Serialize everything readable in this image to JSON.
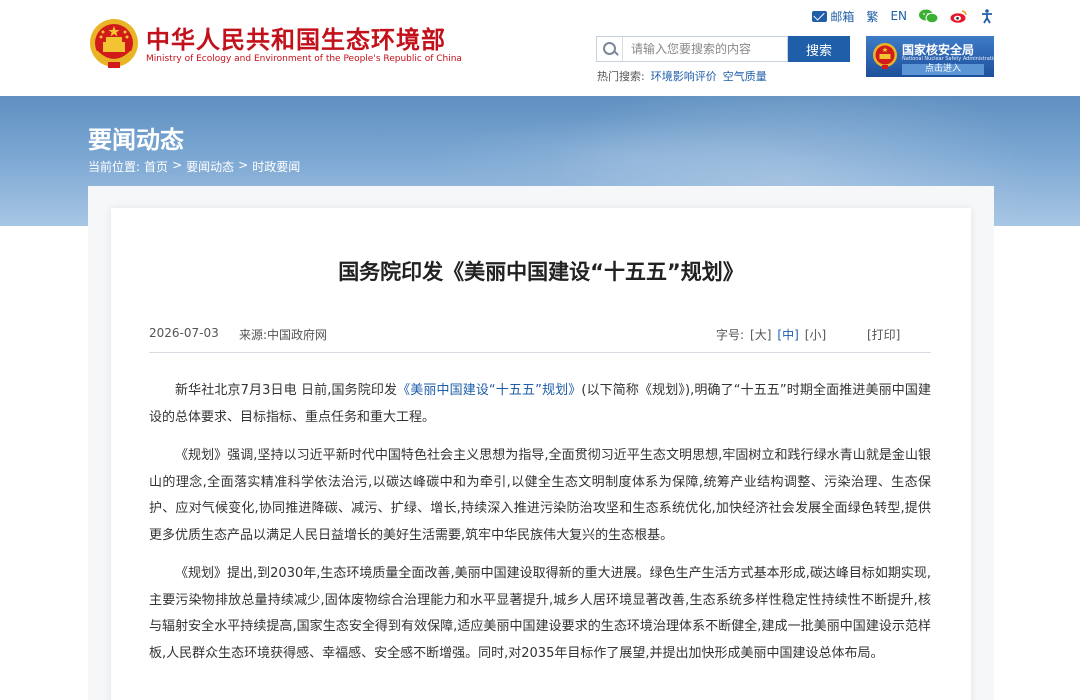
{
  "header": {
    "ministry_cn": "中华人民共和国生态环境部",
    "ministry_en": "Ministry of Ecology and Environment of the People's Republic of China",
    "top_links": {
      "mail": "邮箱",
      "traditional": "繁",
      "english": "EN"
    },
    "search": {
      "placeholder": "请输入您要搜索的内容",
      "button": "搜索"
    },
    "hot_search": {
      "label": "热门搜索:",
      "items": [
        "环境影响评价",
        "空气质量"
      ]
    },
    "nnsa": {
      "name": "国家核安全局",
      "name_en": "National Nuclear Safety Administration",
      "enter": "点击进入"
    }
  },
  "banner": {
    "title": "要闻动态",
    "breadcrumb": {
      "prefix": "当前位置:",
      "items": [
        "首页",
        "要闻动态",
        "时政要闻"
      ],
      "sep": ">"
    }
  },
  "article": {
    "title": "国务院印发《美丽中国建设“十五五”规划》",
    "date": "2026-07-03",
    "source": "来源:中国政府网",
    "font_size": {
      "label": "字号:",
      "large": "[大]",
      "medium": "[中]",
      "small": "[小]"
    },
    "print": "[打印]",
    "paragraph1": {
      "before": "新华社北京7月3日电 日前,国务院印发",
      "link": "《美丽中国建设“十五五”规划》",
      "after": "(以下简称《规划》),明确了“十五五”时期全面推进美丽中国建设的总体要求、目标指标、重点任务和重大工程。"
    },
    "paragraph2": "《规划》强调,坚持以习近平新时代中国特色社会主义思想为指导,全面贯彻习近平生态文明思想,牢固树立和践行绿水青山就是金山银山的理念,全面落实精准科学依法治污,以碳达峰碳中和为牵引,以健全生态文明制度体系为保障,统筹产业结构调整、污染治理、生态保护、应对气候变化,协同推进降碳、减污、扩绿、增长,持续深入推进污染防治攻坚和生态系统优化,加快经济社会发展全面绿色转型,提供更多优质生态产品以满足人民日益增长的美好生活需要,筑牢中华民族伟大复兴的生态根基。",
    "paragraph3": "《规划》提出,到2030年,生态环境质量全面改善,美丽中国建设取得新的重大进展。绿色生产生活方式基本形成,碳达峰目标如期实现,主要污染物排放总量持续减少,固体废物综合治理能力和水平显著提升,城乡人居环境显著改善,生态系统多样性稳定性持续性不断提升,核与辐射安全水平持续提高,国家生态安全得到有效保障,适应美丽中国建设要求的生态环境治理体系不断健全,建成一批美丽中国建设示范样板,人民群众生态环境获得感、幸福感、安全感不断增强。同时,对2035年目标作了展望,并提出加快形成美丽中国建设总体布局。"
  },
  "colors": {
    "brand_red": "#c3111b",
    "link_blue": "#1f5ea8",
    "banner_blue": "#6e9ccb"
  }
}
